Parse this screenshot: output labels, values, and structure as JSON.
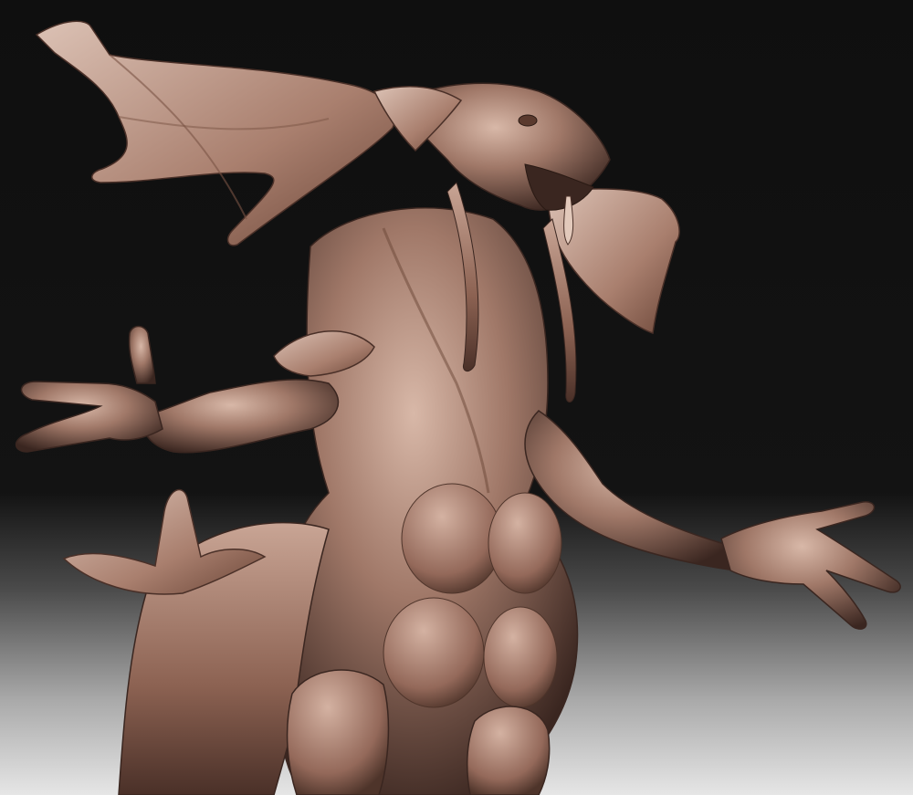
{
  "scene": {
    "subject": "clay-sculpt-creature",
    "material_color": "#a07868",
    "highlight_color": "#d8b8a8",
    "shadow_color": "#3a2620",
    "background_top": "#0f0f0f",
    "background_bottom": "#e6e6e6"
  }
}
